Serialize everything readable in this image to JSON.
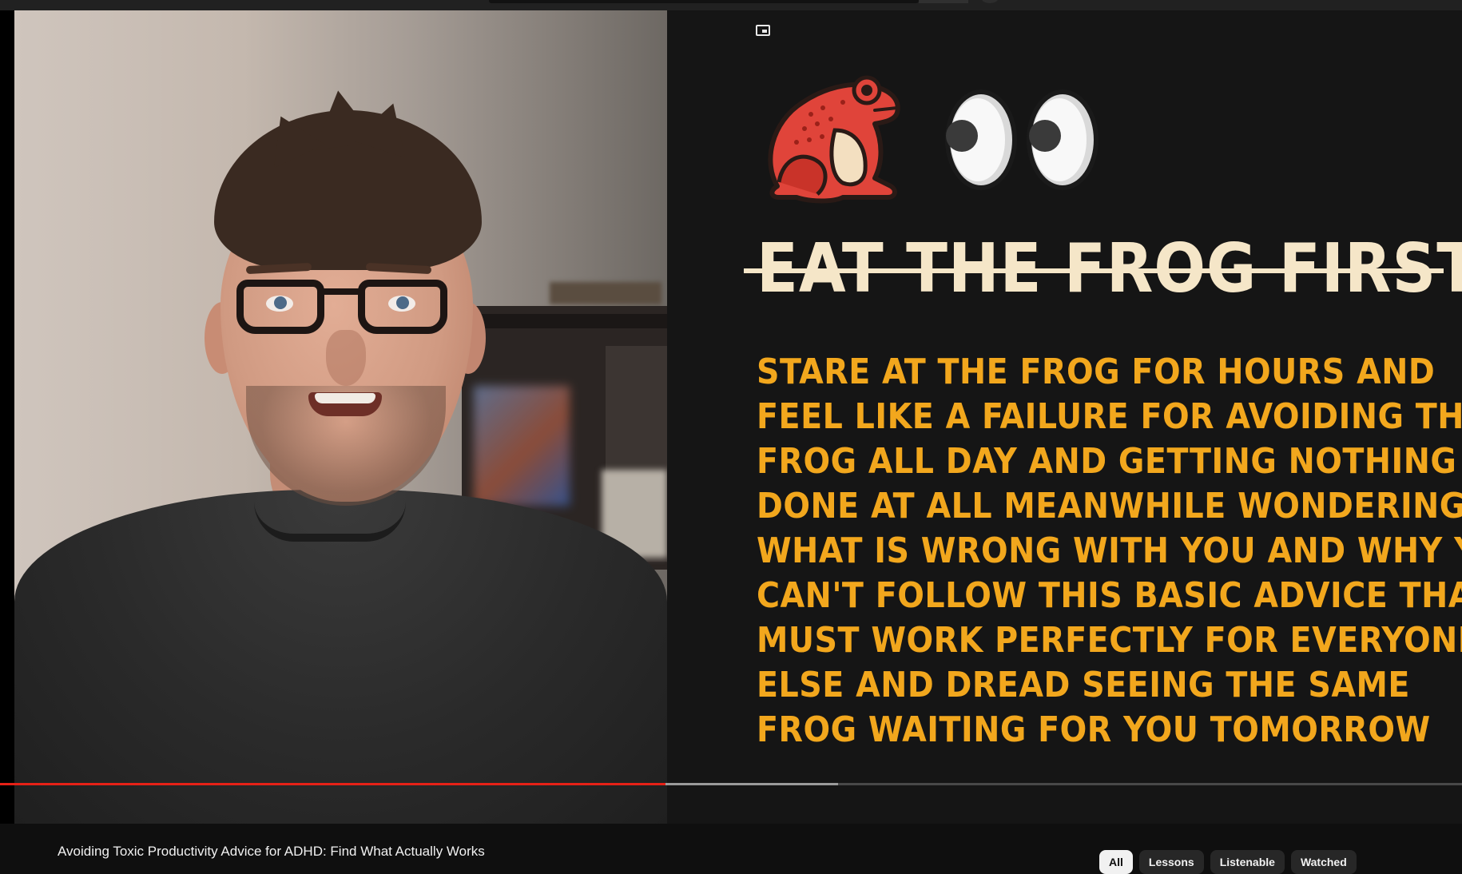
{
  "video": {
    "title": "Avoiding Toxic Productivity Advice for ADHD: Find What Actually Works",
    "progress_played": 0.455,
    "progress_buffered": 0.573
  },
  "slide": {
    "title": "EAT THE FROG FIRST",
    "title_struck_through": true,
    "body_lines": [
      "STARE AT THE FROG FOR HOURS AND",
      "FEEL LIKE A FAILURE FOR AVOIDING THE",
      "FROG ALL DAY AND GETTING NOTHING",
      "DONE AT ALL MEANWHILE WONDERING",
      "WHAT IS WRONG WITH YOU AND WHY YOU",
      "CAN'T FOLLOW THIS BASIC ADVICE THAT",
      "MUST WORK PERFECTLY FOR EVERYONE",
      "ELSE AND DREAD SEEING THE SAME",
      "FROG WAITING FOR YOU TOMORROW"
    ],
    "icons": [
      "frog-icon",
      "googly-eyes-icon",
      "miniplayer-icon"
    ],
    "colors": {
      "title": "#f5e6c8",
      "body": "#f2a71d",
      "frog": "#e0443a",
      "background": "#151515"
    }
  },
  "chips": [
    {
      "label": "All",
      "active": true
    },
    {
      "label": "Lessons",
      "active": false
    },
    {
      "label": "Listenable",
      "active": false
    },
    {
      "label": "Watched",
      "active": false
    }
  ],
  "theme": {
    "progress_color": "#e62117",
    "page_bg": "#0f0f0f"
  }
}
